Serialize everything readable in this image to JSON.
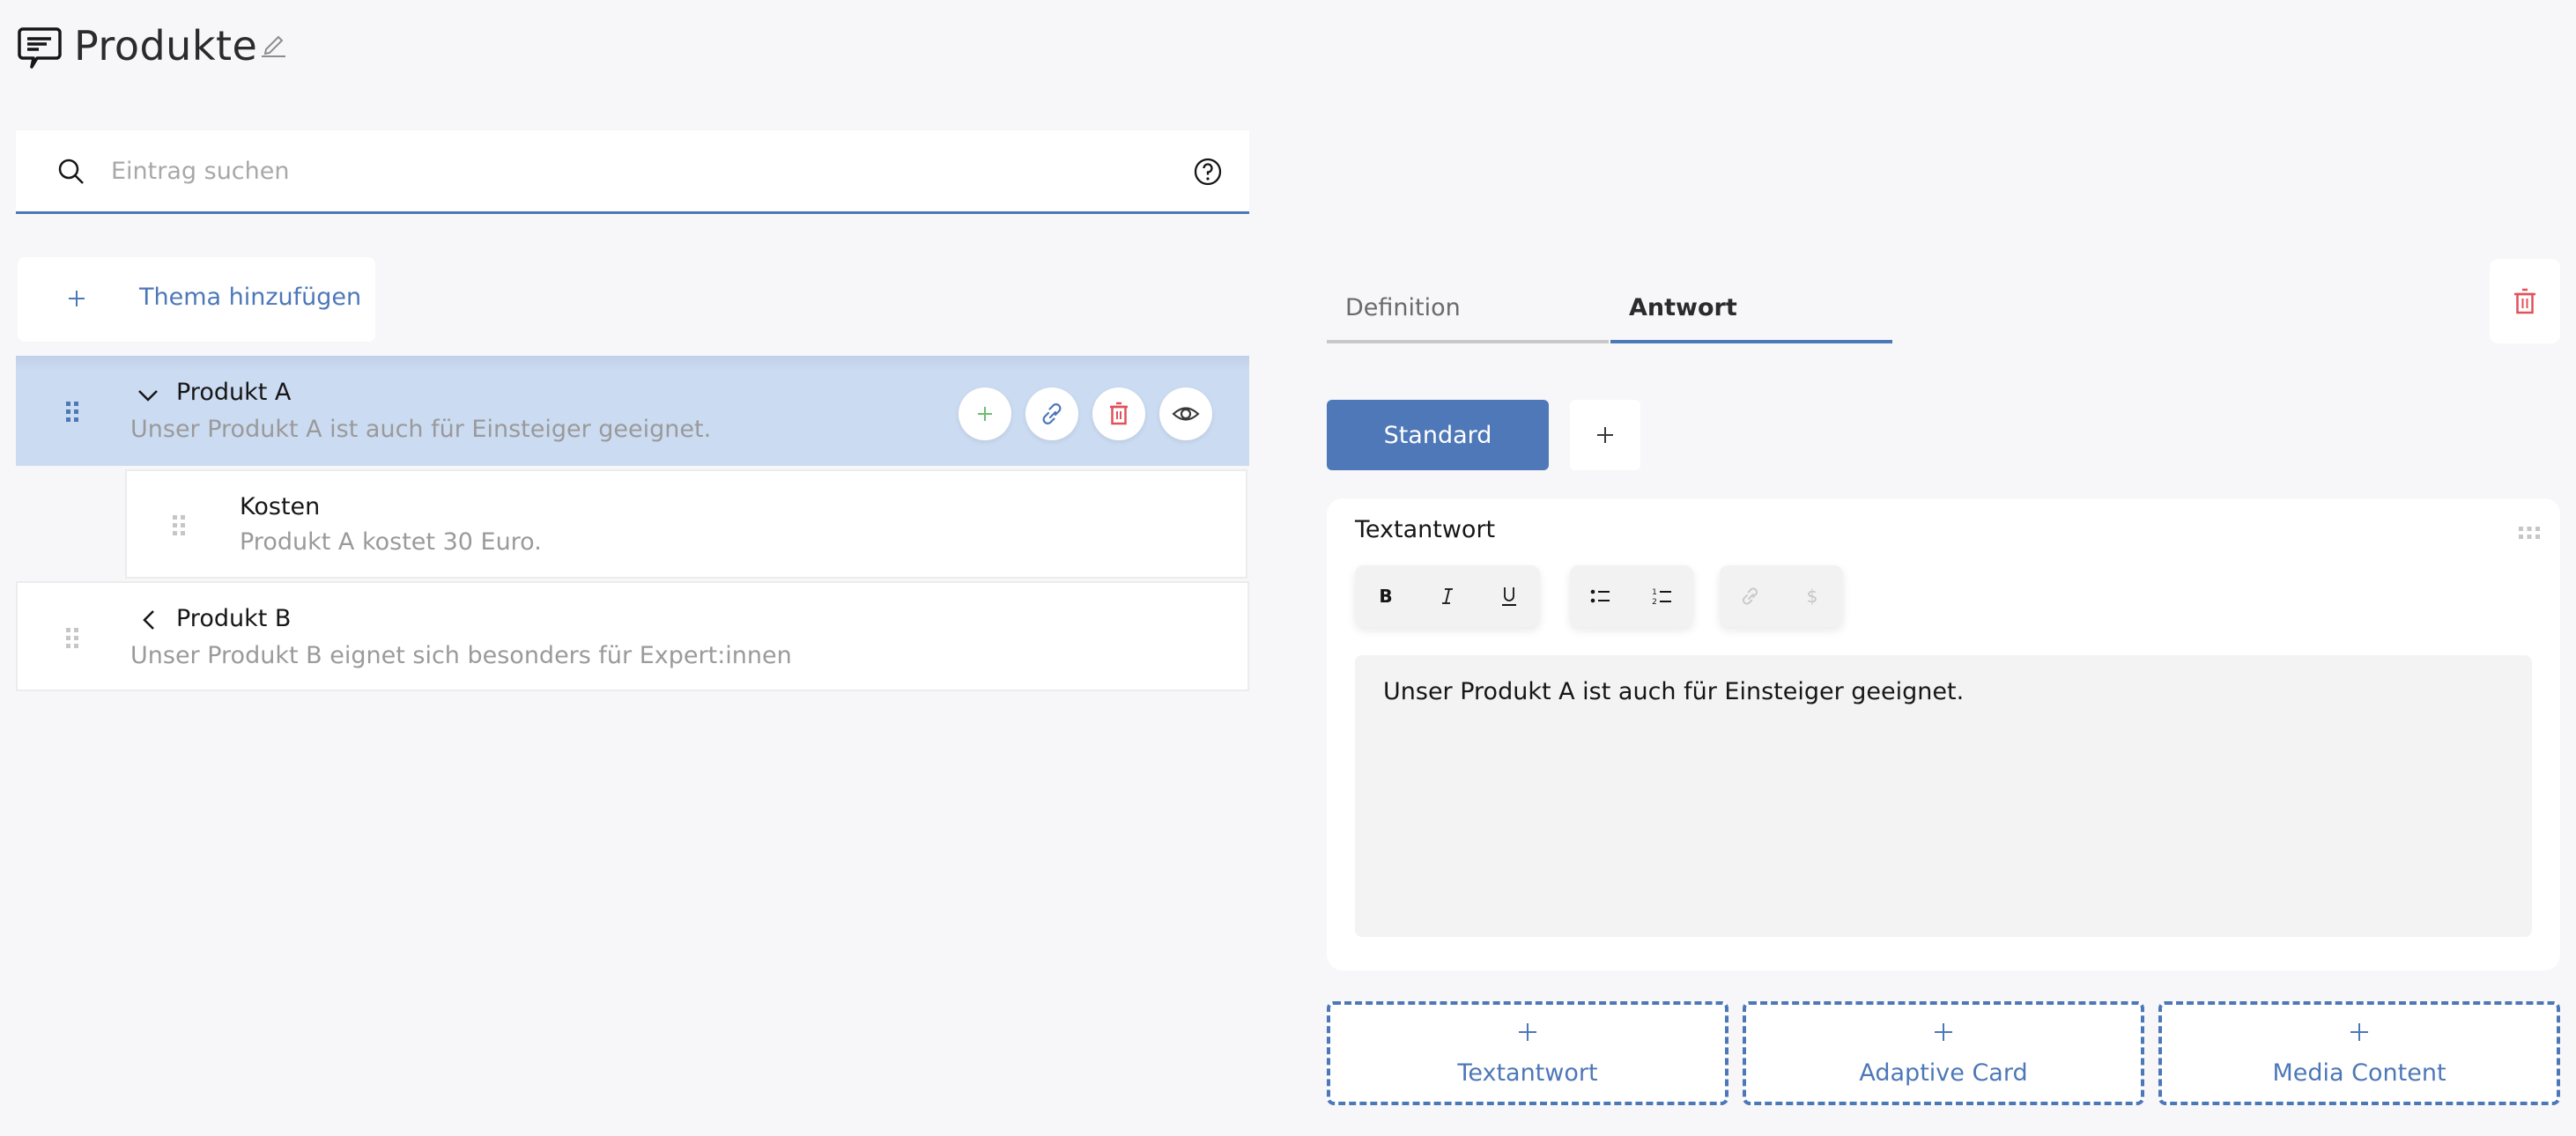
{
  "header": {
    "title": "Produkte",
    "icon": "chat-bubble-icon",
    "edit_icon": "pencil-icon"
  },
  "search": {
    "placeholder": "Eintrag suchen",
    "value": "",
    "icon": "search-icon",
    "help_icon": "help-icon"
  },
  "add_topic": {
    "label": "Thema hinzufügen",
    "icon": "plus-icon"
  },
  "tree": {
    "items": [
      {
        "title": "Produkt A",
        "description": "Unser Produkt A ist auch für Einsteiger geeignet.",
        "expanded": true,
        "selected": true,
        "actions": [
          "add",
          "link",
          "delete",
          "preview"
        ],
        "children": [
          {
            "title": "Kosten",
            "description": "Produkt A kostet 30 Euro."
          }
        ]
      },
      {
        "title": "Produkt B",
        "description": "Unser Produkt B eignet sich besonders für Expert:innen",
        "expanded": false,
        "selected": false
      }
    ]
  },
  "detail": {
    "tabs": [
      {
        "label": "Definition",
        "active": false
      },
      {
        "label": "Antwort",
        "active": true
      }
    ],
    "variants": [
      {
        "label": "Standard",
        "active": true
      }
    ],
    "card": {
      "title": "Textantwort",
      "toolbar": {
        "groups": [
          [
            {
              "name": "bold",
              "label": "B",
              "enabled": true
            },
            {
              "name": "italic",
              "label": "I",
              "enabled": true
            },
            {
              "name": "underline",
              "label": "U",
              "enabled": true
            }
          ],
          [
            {
              "name": "bullet-list",
              "enabled": true
            },
            {
              "name": "numbered-list",
              "enabled": true
            }
          ],
          [
            {
              "name": "link",
              "enabled": false
            },
            {
              "name": "variable",
              "label": "$",
              "enabled": false
            }
          ]
        ]
      },
      "content": "Unser Produkt A ist auch für Einsteiger geeignet."
    },
    "add_blocks": [
      {
        "label": "Textantwort"
      },
      {
        "label": "Adaptive Card"
      },
      {
        "label": "Media Content"
      }
    ]
  },
  "colors": {
    "accent": "#4d78b8",
    "selected_row": "#cbdbf1",
    "danger": "#e0525a",
    "success": "#6ac06f",
    "background": "#f7f7f9"
  }
}
